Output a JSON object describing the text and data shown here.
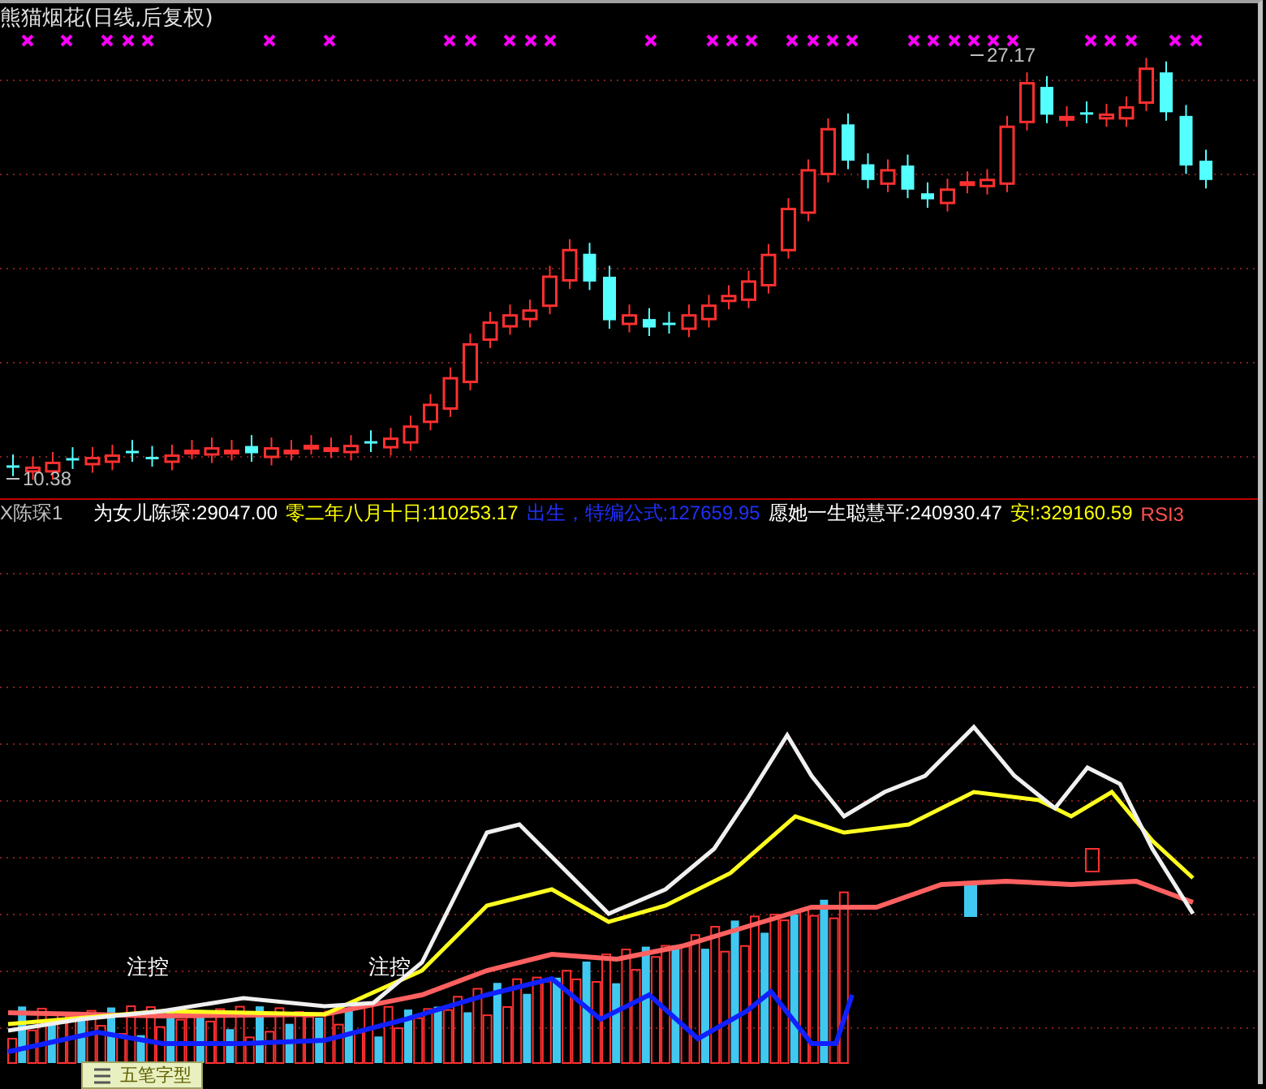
{
  "main_chart": {
    "title": "熊猫烟花(日线,后复权)",
    "price_labels": [
      {
        "kind": "high",
        "text": "27.17"
      },
      {
        "kind": "low",
        "text": "10.38"
      }
    ]
  },
  "indicator": {
    "name": "X陈琛1",
    "values": [
      {
        "text": "为女儿陈琛:29047.00",
        "color": "#ffffff"
      },
      {
        "text": "零二年八月十日:110253.17",
        "color": "#ffff00"
      },
      {
        "text": "出生，特编公式:127659.95",
        "color": "#2030ff"
      },
      {
        "text": "愿她一生聪慧平:240930.47",
        "color": "#ffffff"
      },
      {
        "text": "安!:329160.59",
        "color": "#ffff00"
      },
      {
        "text": "RSI3",
        "color": "#ff5050"
      }
    ],
    "annotations": [
      "注控",
      "注控"
    ]
  },
  "ime_bar": {
    "text": "五笔字型"
  }
}
